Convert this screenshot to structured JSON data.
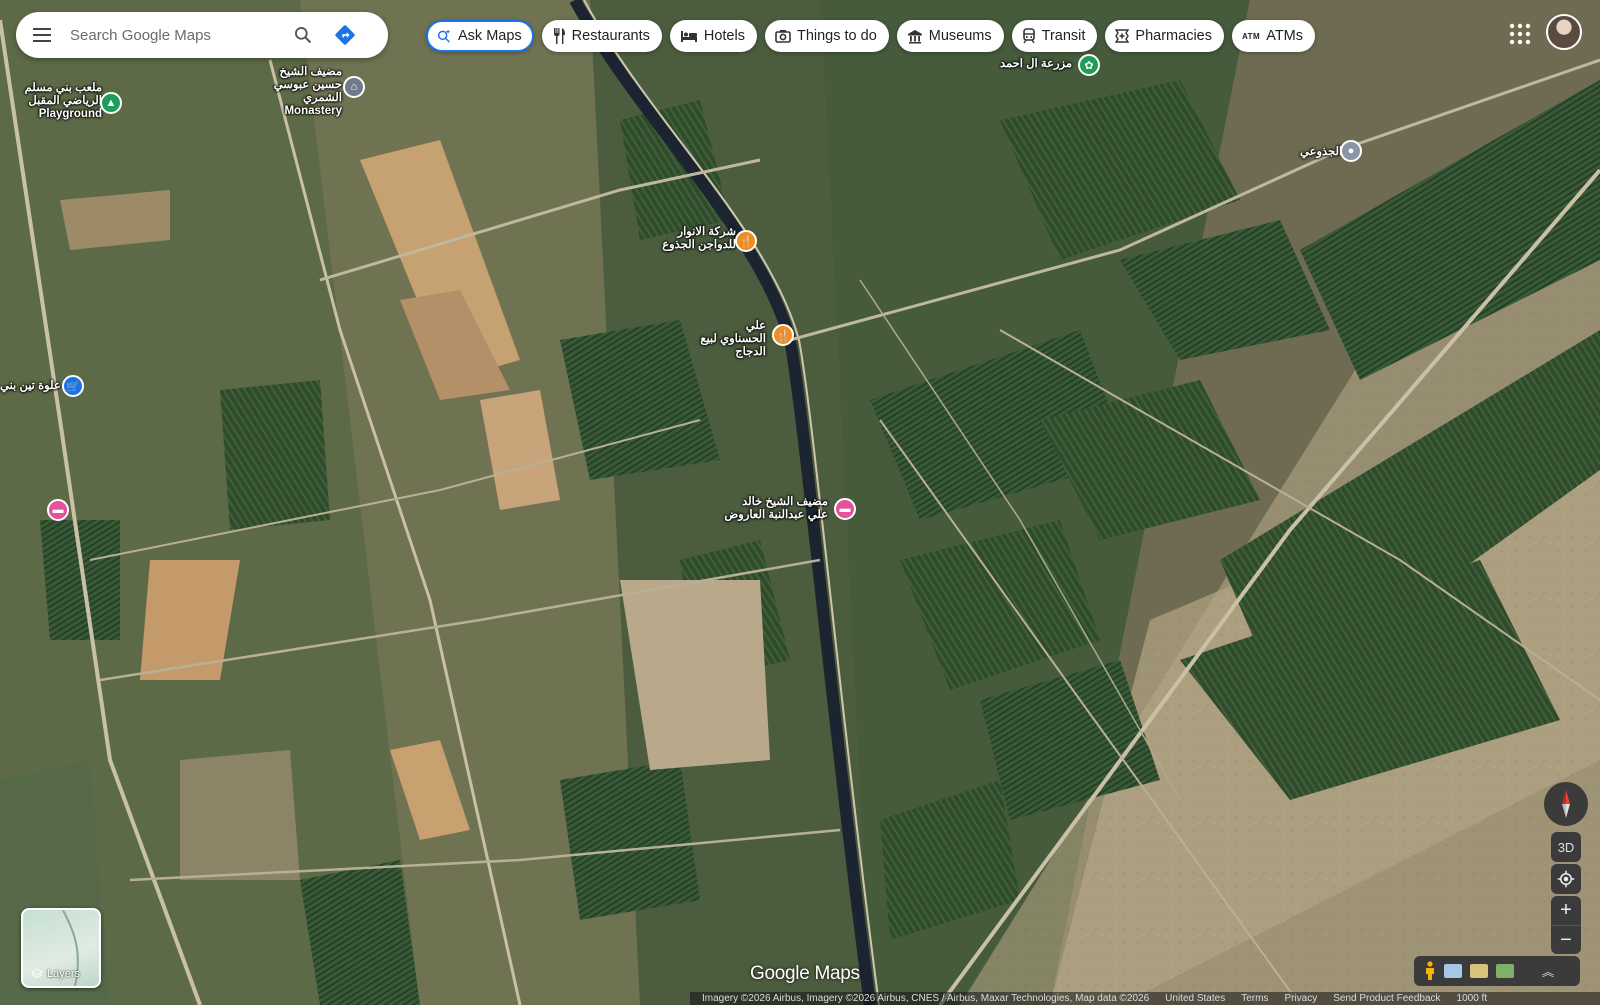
{
  "search": {
    "placeholder": "Search Google Maps"
  },
  "chips": [
    {
      "label": "Ask Maps"
    },
    {
      "label": "Restaurants"
    },
    {
      "label": "Hotels"
    },
    {
      "label": "Things to do"
    },
    {
      "label": "Museums"
    },
    {
      "label": "Transit"
    },
    {
      "label": "Pharmacies"
    },
    {
      "label": "ATMs"
    }
  ],
  "chip_atm_glyph": "ATM",
  "places": {
    "monastery_name": "مضيف الشيخ حسين عبوسي الشمري",
    "monastery_type": "Monastery",
    "playground_name": "ملعب بني مسلم الرياضي المقبل",
    "playground_type": "Playground",
    "farm": "مزرعة ال احمد",
    "village": "الجذوعي",
    "restaurant1": "شركة الانوار للدواجن الجذوع",
    "restaurant2": "علي الحسناوي لبيع الدجاج",
    "shop": "علوة تين بني",
    "hotel": "مضيف الشيخ خالد علي عبدالنبة العاروض"
  },
  "controls": {
    "label_3d": "3D",
    "zoom_in": "+",
    "zoom_out": "−",
    "layers_label": "Layers",
    "expand": "︽"
  },
  "brand": "Google Maps",
  "footer": {
    "imagery": "Imagery ©2026 Airbus, Imagery ©2026 Airbus, CNES / Airbus, Maxar Technologies, Map data ©2026",
    "country": "United States",
    "terms": "Terms",
    "privacy": "Privacy",
    "feedback": "Send Product Feedback",
    "scale": "1000 ft"
  },
  "colors": {
    "restaurant_pin": "#f28c1e",
    "hotel_pin": "#e3529b",
    "shop_pin": "#1a73e8",
    "park_pin": "#1e9e5a",
    "attraction_pin": "#6f7b8a",
    "accent": "#1a73e8"
  }
}
